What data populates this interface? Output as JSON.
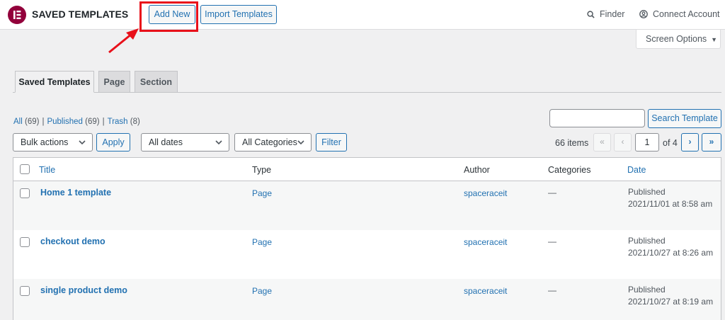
{
  "header": {
    "app_title": "SAVED TEMPLATES",
    "add_new": "Add New",
    "import_templates": "Import Templates",
    "finder": "Finder",
    "connect_account": "Connect Account",
    "screen_options": "Screen Options"
  },
  "tabs": [
    {
      "label": "Saved Templates",
      "active": true
    },
    {
      "label": "Page",
      "active": false
    },
    {
      "label": "Section",
      "active": false
    }
  ],
  "views": {
    "all_label": "All",
    "all_count": "(69)",
    "published_label": "Published",
    "published_count": "(69)",
    "trash_label": "Trash",
    "trash_count": "(8)"
  },
  "search": {
    "placeholder": "",
    "button": "Search Template"
  },
  "filters": {
    "bulk_actions": "Bulk actions",
    "apply": "Apply",
    "dates": "All dates",
    "categories": "All Categories",
    "filter": "Filter"
  },
  "pagination": {
    "items": "66 items",
    "first": "«",
    "prev": "‹",
    "current": "1",
    "of_total": "of 4",
    "next": "›",
    "last": "»"
  },
  "table": {
    "columns": {
      "title": "Title",
      "type": "Type",
      "author": "Author",
      "categories": "Categories",
      "date": "Date"
    },
    "rows": [
      {
        "title": "Home 1 template",
        "type": "Page",
        "author": "spaceraceit",
        "categories": "—",
        "status": "Published",
        "date": "2021/11/01 at 8:58 am"
      },
      {
        "title": "checkout demo",
        "type": "Page",
        "author": "spaceraceit",
        "categories": "—",
        "status": "Published",
        "date": "2021/10/27 at 8:26 am"
      },
      {
        "title": "single product demo",
        "type": "Page",
        "author": "spaceraceit",
        "categories": "—",
        "status": "Published",
        "date": "2021/10/27 at 8:19 am"
      }
    ]
  },
  "colors": {
    "brand": "#92003b",
    "link": "#2271b1",
    "highlight": "#e8101a",
    "background": "#f0f0f1"
  }
}
